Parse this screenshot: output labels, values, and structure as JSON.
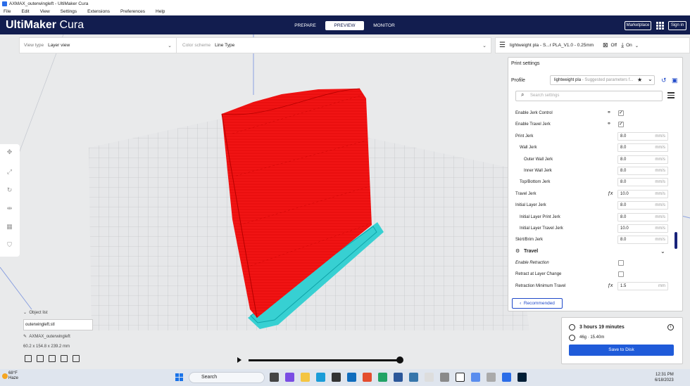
{
  "window": {
    "title": "AXMAX_outerwingleft - UltiMaker Cura"
  },
  "menu": [
    "File",
    "Edit",
    "View",
    "Settings",
    "Extensions",
    "Preferences",
    "Help"
  ],
  "header": {
    "brand_bold": "UltiMaker",
    "brand_light": " Cura",
    "stages": [
      "PREPARE",
      "PREVIEW",
      "MONITOR"
    ],
    "active_stage": "PREVIEW",
    "marketplace": "Marketplace",
    "signin": "Sign in"
  },
  "viewbar": {
    "view_type_label": "View type",
    "view_type_value": "Layer view",
    "color_scheme_label": "Color scheme",
    "color_scheme_value": "Line Type"
  },
  "profilebar": {
    "profile_text": "lightweight pla - S...r PLA_V1.0 - 0.25mm",
    "support_off": "Off",
    "adhesion_on": "On"
  },
  "print_settings": {
    "title": "Print settings",
    "profile_label": "Profile",
    "profile_value": "lightweight pla",
    "profile_suggest": " - Suggested parameters f...",
    "search_placeholder": "Search settings",
    "rows": [
      {
        "label": "Enable Jerk Control",
        "type": "check",
        "checked": true,
        "link": true,
        "indent": 0
      },
      {
        "label": "Enable Travel Jerk",
        "type": "check",
        "checked": true,
        "link": true,
        "indent": 0
      },
      {
        "label": "Print Jerk",
        "type": "field",
        "value": "8.0",
        "unit": "mm/s",
        "indent": 0
      },
      {
        "label": "Wall Jerk",
        "type": "field",
        "value": "8.0",
        "unit": "mm/s",
        "indent": 1
      },
      {
        "label": "Outer Wall Jerk",
        "type": "field",
        "value": "8.0",
        "unit": "mm/s",
        "indent": 2
      },
      {
        "label": "Inner Wall Jerk",
        "type": "field",
        "value": "8.0",
        "unit": "mm/s",
        "indent": 2
      },
      {
        "label": "Top/Bottom Jerk",
        "type": "field",
        "value": "8.0",
        "unit": "mm/s",
        "indent": 1
      },
      {
        "label": "Travel Jerk",
        "type": "field",
        "value": "10.0",
        "unit": "mm/s",
        "fx": true,
        "indent": 0
      },
      {
        "label": "Initial Layer Jerk",
        "type": "field",
        "value": "8.0",
        "unit": "mm/s",
        "indent": 0
      },
      {
        "label": "Initial Layer Print Jerk",
        "type": "field",
        "value": "8.0",
        "unit": "mm/s",
        "indent": 1
      },
      {
        "label": "Initial Layer Travel Jerk",
        "type": "field",
        "value": "10.0",
        "unit": "mm/s",
        "indent": 1
      },
      {
        "label": "Skirt/Brim Jerk",
        "type": "field",
        "value": "8.0",
        "unit": "mm/s",
        "indent": 0
      },
      {
        "label": "Travel",
        "type": "header",
        "indent": 0
      },
      {
        "label": "Enable Retraction",
        "type": "check",
        "checked": false,
        "italic": true,
        "indent": 0
      },
      {
        "label": "Retract at Layer Change",
        "type": "check",
        "checked": false,
        "indent": 0
      },
      {
        "label": "Retraction Minimum Travel",
        "type": "field",
        "value": "1.5",
        "unit": "mm",
        "fx": true,
        "indent": 0
      }
    ],
    "recommended": "Recommended"
  },
  "output": {
    "time": "3 hours 19 minutes",
    "material": "46g · 15.40m",
    "save": "Save to Disk"
  },
  "objects": {
    "list_label": "Object list",
    "selected_name": "outerwingleft.stl",
    "file": "AXMAX_outerwingleft",
    "dimensions": "60.2 x 154.8 x 239.2 mm"
  },
  "taskbar": {
    "temp": "68°F",
    "weather": "Haze",
    "search": "Search",
    "time": "12:31 PM",
    "date": "6/18/2023"
  }
}
